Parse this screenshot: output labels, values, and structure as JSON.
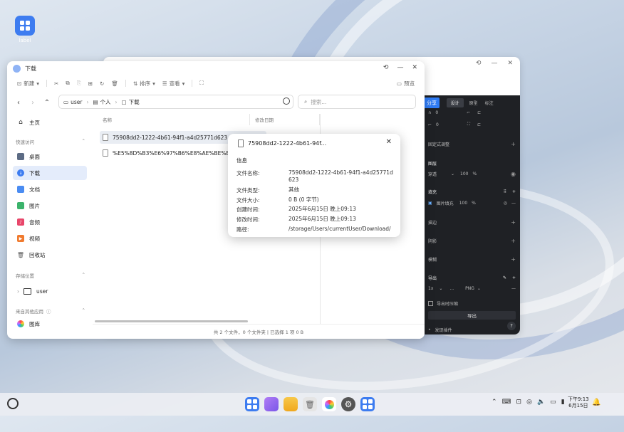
{
  "desktop": {
    "icon_label": "label"
  },
  "explorer": {
    "title": "下载",
    "toolbar": {
      "new": "新建",
      "sort": "排序",
      "view": "查看",
      "preview": "预览"
    },
    "path": {
      "c0": "user",
      "c1": "个人",
      "c2": "下载"
    },
    "search_placeholder": "搜索...",
    "sidebar": {
      "home": "主页",
      "quick_access": "快速访问",
      "items": [
        "桌面",
        "下载",
        "文档",
        "图片",
        "音频",
        "视频",
        "回收站"
      ],
      "storage": "存储位置",
      "storage_user": "user",
      "other_apps": "来自其他应用",
      "gallery": "图库"
    },
    "columns": {
      "name": "名称",
      "modified": "修改日期"
    },
    "files": [
      {
        "name": "75908dd2-1222-4b61-94f1-a4d25771d623"
      },
      {
        "name": "%E5%8D%B3%E6%97%B6%E8%AE%BE%E8"
      }
    ],
    "status": "共 2 个文件，0 个文件夹 | 已选择 1 项  0 B"
  },
  "popup": {
    "title": "75908dd2-1222-4b61-94f...",
    "section": "信息",
    "rows": [
      {
        "k": "文件名称:",
        "v": "75908dd2-1222-4b61-94f1-a4d25771d623"
      },
      {
        "k": "文件类型:",
        "v": "其他"
      },
      {
        "k": "文件大小:",
        "v": "0 B (0 字节)"
      },
      {
        "k": "创建时间:",
        "v": "2025年6月15日 晚上09:13"
      },
      {
        "k": "修改时间:",
        "v": "2025年6月15日 晚上09:13"
      },
      {
        "k": "路径:",
        "v": "/storage/Users/currentUser/Download/"
      }
    ]
  },
  "design_panel": {
    "share": "分享",
    "tabs": [
      "设计",
      "原型",
      "标注"
    ],
    "x0": "0",
    "x1": "0",
    "constraint": "固定式调整",
    "layer": "图层",
    "pass_through": "穿透",
    "opacity1": "100",
    "pct": "%",
    "fill": "填充",
    "fill_name": "图片填充",
    "opacity2": "100",
    "stroke": "描边",
    "shadow": "阴影",
    "blur": "模糊",
    "export": "导出",
    "scale": "1x",
    "suffix": "...",
    "format": "PNG",
    "export_opt": "导出时压缩",
    "export_btn": "导出",
    "hint": "发现插件",
    "help": "?"
  },
  "taskbar": {
    "time": "下午9:13",
    "date": "6月15日"
  }
}
